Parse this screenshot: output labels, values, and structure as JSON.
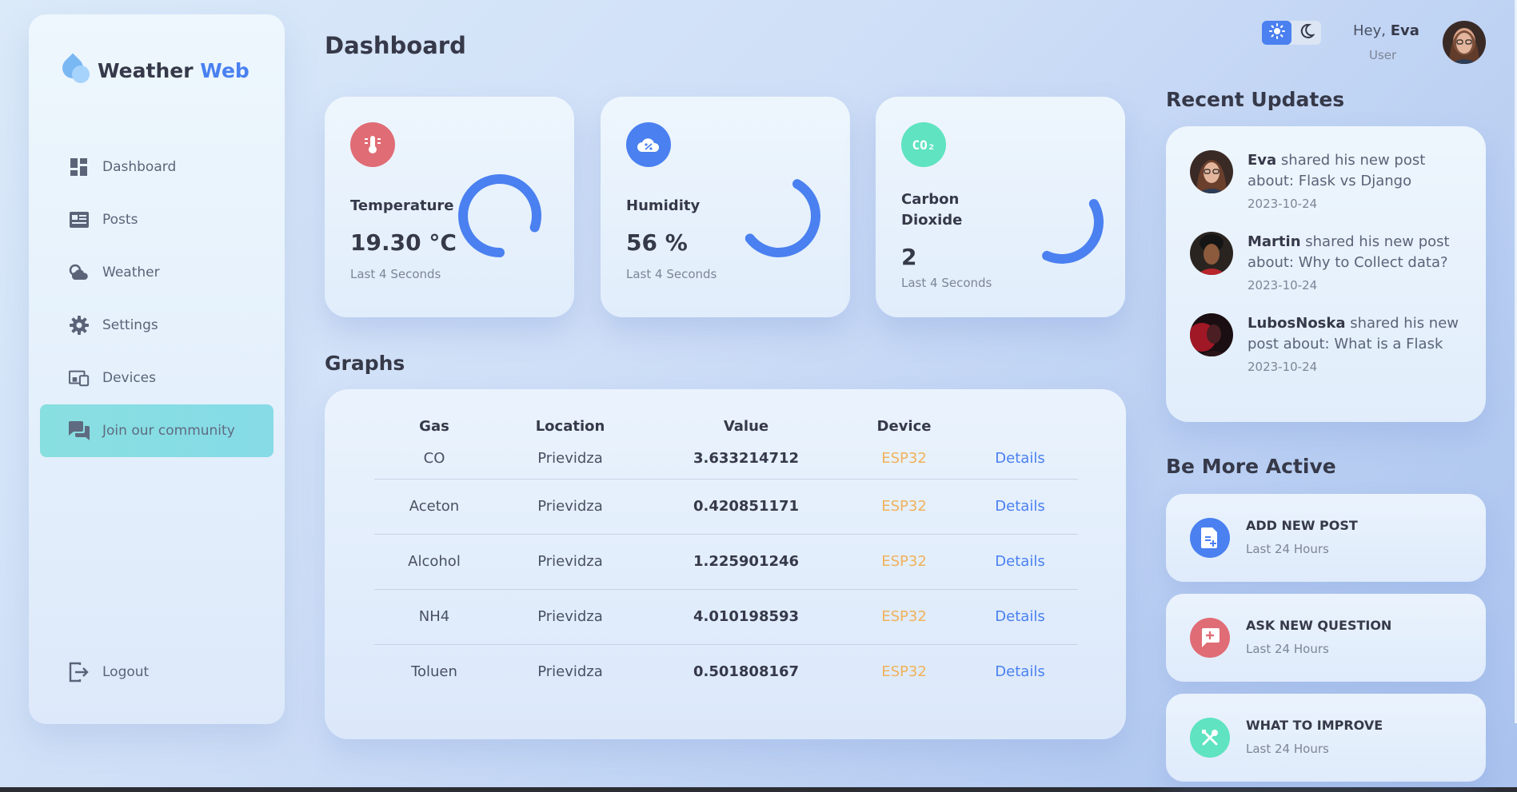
{
  "brand": {
    "name_part1": "Weather",
    "name_part2": "Web"
  },
  "sidebar": {
    "items": [
      {
        "label": "Dashboard",
        "icon": "dashboard-icon"
      },
      {
        "label": "Posts",
        "icon": "posts-icon"
      },
      {
        "label": "Weather",
        "icon": "weather-icon"
      },
      {
        "label": "Settings",
        "icon": "gear-icon"
      },
      {
        "label": "Devices",
        "icon": "devices-icon"
      },
      {
        "label": "Join our community",
        "icon": "chat-icon",
        "active": true
      }
    ],
    "logout_label": "Logout"
  },
  "header": {
    "title": "Dashboard"
  },
  "profile": {
    "greeting": "Hey,",
    "name": "Eva",
    "role": "User"
  },
  "cards": [
    {
      "label": "Temperature",
      "value": "19.30 °C",
      "sub": "Last 4 Seconds",
      "icon": "thermometer-icon",
      "color": "#e06c75",
      "progress": 0.8
    },
    {
      "label": "Humidity",
      "value": "56 %",
      "sub": "Last 4 Seconds",
      "icon": "humidity-cloud-icon",
      "color": "#4a80f0",
      "progress": 0.56
    },
    {
      "label": "Carbon Dioxide",
      "value": "2",
      "sub": "Last 4 Seconds",
      "icon": "co2-icon",
      "color": "#5fe3c1",
      "progress": 0.4
    }
  ],
  "graphs": {
    "title": "Graphs",
    "columns": [
      "Gas",
      "Location",
      "Value",
      "Device",
      ""
    ],
    "rows": [
      {
        "gas": "CO",
        "location": "Prievidza",
        "value": "3.633214712",
        "device": "ESP32",
        "action": "Details"
      },
      {
        "gas": "Aceton",
        "location": "Prievidza",
        "value": "0.420851171",
        "device": "ESP32",
        "action": "Details"
      },
      {
        "gas": "Alcohol",
        "location": "Prievidza",
        "value": "1.225901246",
        "device": "ESP32",
        "action": "Details"
      },
      {
        "gas": "NH4",
        "location": "Prievidza",
        "value": "4.010198593",
        "device": "ESP32",
        "action": "Details"
      },
      {
        "gas": "Toluen",
        "location": "Prievidza",
        "value": "0.501808167",
        "device": "ESP32",
        "action": "Details"
      }
    ]
  },
  "updates": {
    "title": "Recent Updates",
    "items": [
      {
        "name": "Eva",
        "text": " shared his new post about: Flask vs Django",
        "date": "2023-10-24"
      },
      {
        "name": "Martin",
        "text": " shared his new post about: Why to Collect data?",
        "date": "2023-10-24"
      },
      {
        "name": "LubosNoska",
        "text": " shared his new post about: What is a Flask",
        "date": "2023-10-24"
      }
    ]
  },
  "be_active": {
    "title": "Be More Active",
    "items": [
      {
        "title": "ADD NEW POST",
        "sub": "Last 24 Hours",
        "icon": "add-post-icon",
        "color": "#4a80f0"
      },
      {
        "title": "ASK NEW QUESTION",
        "sub": "Last 24 Hours",
        "icon": "question-icon",
        "color": "#e06c75"
      },
      {
        "title": "WHAT TO IMPROVE",
        "sub": "Last 24 Hours",
        "icon": "tools-icon",
        "color": "#5fe3c1"
      }
    ]
  }
}
